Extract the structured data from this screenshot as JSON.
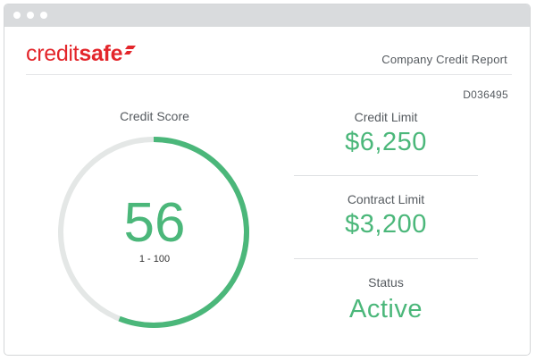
{
  "window": {
    "controls": [
      "dot-1",
      "dot-2",
      "dot-3"
    ]
  },
  "brand": {
    "logo_light": "credit",
    "logo_bold": "safe",
    "color": "#e3262b",
    "icon": "creditsafe-logo-mark-icon"
  },
  "header": {
    "report_title": "Company Credit Report",
    "report_id": "D036495"
  },
  "credit_score": {
    "label": "Credit Score",
    "value": "56",
    "range": "1 - 100",
    "score_number": 56,
    "min": 1,
    "max": 100,
    "fill_color": "#4bb77a",
    "track_color": "#e4e7e6"
  },
  "metrics": [
    {
      "label": "Credit Limit",
      "value": "$6,250"
    },
    {
      "label": "Contract Limit",
      "value": "$3,200"
    },
    {
      "label": "Status",
      "value": "Active"
    }
  ],
  "colors": {
    "accent_green": "#4bb77a",
    "text_gray": "#555a5f"
  }
}
